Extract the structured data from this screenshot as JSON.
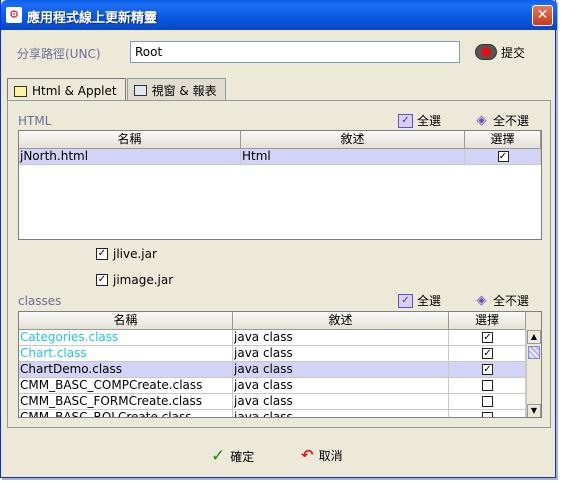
{
  "window": {
    "title": "應用程式線上更新精靈",
    "close_label": "✕"
  },
  "unc": {
    "label": "分享路徑(UNC)",
    "value": "Root",
    "submit_label": "提交"
  },
  "tabs": [
    {
      "label": "Html & Applet",
      "active": true
    },
    {
      "label": "視窗 & 報表",
      "active": false
    }
  ],
  "html_section": {
    "label": "HTML",
    "select_all": "全選",
    "select_none": "全不選",
    "columns": [
      "名稱",
      "敘述",
      "選擇"
    ],
    "rows": [
      {
        "name": "jNorth.html",
        "desc": "Html",
        "checked": true,
        "selected": true
      }
    ]
  },
  "jars": [
    {
      "label": "jlive.jar",
      "checked": true
    },
    {
      "label": "jimage.jar",
      "checked": true
    }
  ],
  "classes_section": {
    "label": "classes",
    "select_all": "全選",
    "select_none": "全不選",
    "columns": [
      "名稱",
      "敘述",
      "選擇"
    ],
    "rows": [
      {
        "name": "Categories.class",
        "desc": "java class",
        "checked": true,
        "selected": false,
        "cyan": true
      },
      {
        "name": "Chart.class",
        "desc": "java class",
        "checked": true,
        "selected": false,
        "cyan": true
      },
      {
        "name": "ChartDemo.class",
        "desc": "java class",
        "checked": true,
        "selected": true,
        "cyan": false
      },
      {
        "name": "CMM_BASC_COMPCreate.class",
        "desc": "java class",
        "checked": false,
        "selected": false,
        "cyan": false
      },
      {
        "name": "CMM_BASC_FORMCreate.class",
        "desc": "java class",
        "checked": false,
        "selected": false,
        "cyan": false
      },
      {
        "name": "CMM_BASC_ROLCreate.class",
        "desc": "java class",
        "checked": false,
        "selected": false,
        "cyan": false
      }
    ]
  },
  "footer": {
    "ok_label": "確定",
    "cancel_label": "取消"
  },
  "colors": {
    "titlebar": "#0a58e0",
    "dialog_bg": "#ece9d8",
    "label_muted": "#6d6d9a",
    "selected_row": "#d3d3f5",
    "link_cyan": "#22c6de"
  }
}
